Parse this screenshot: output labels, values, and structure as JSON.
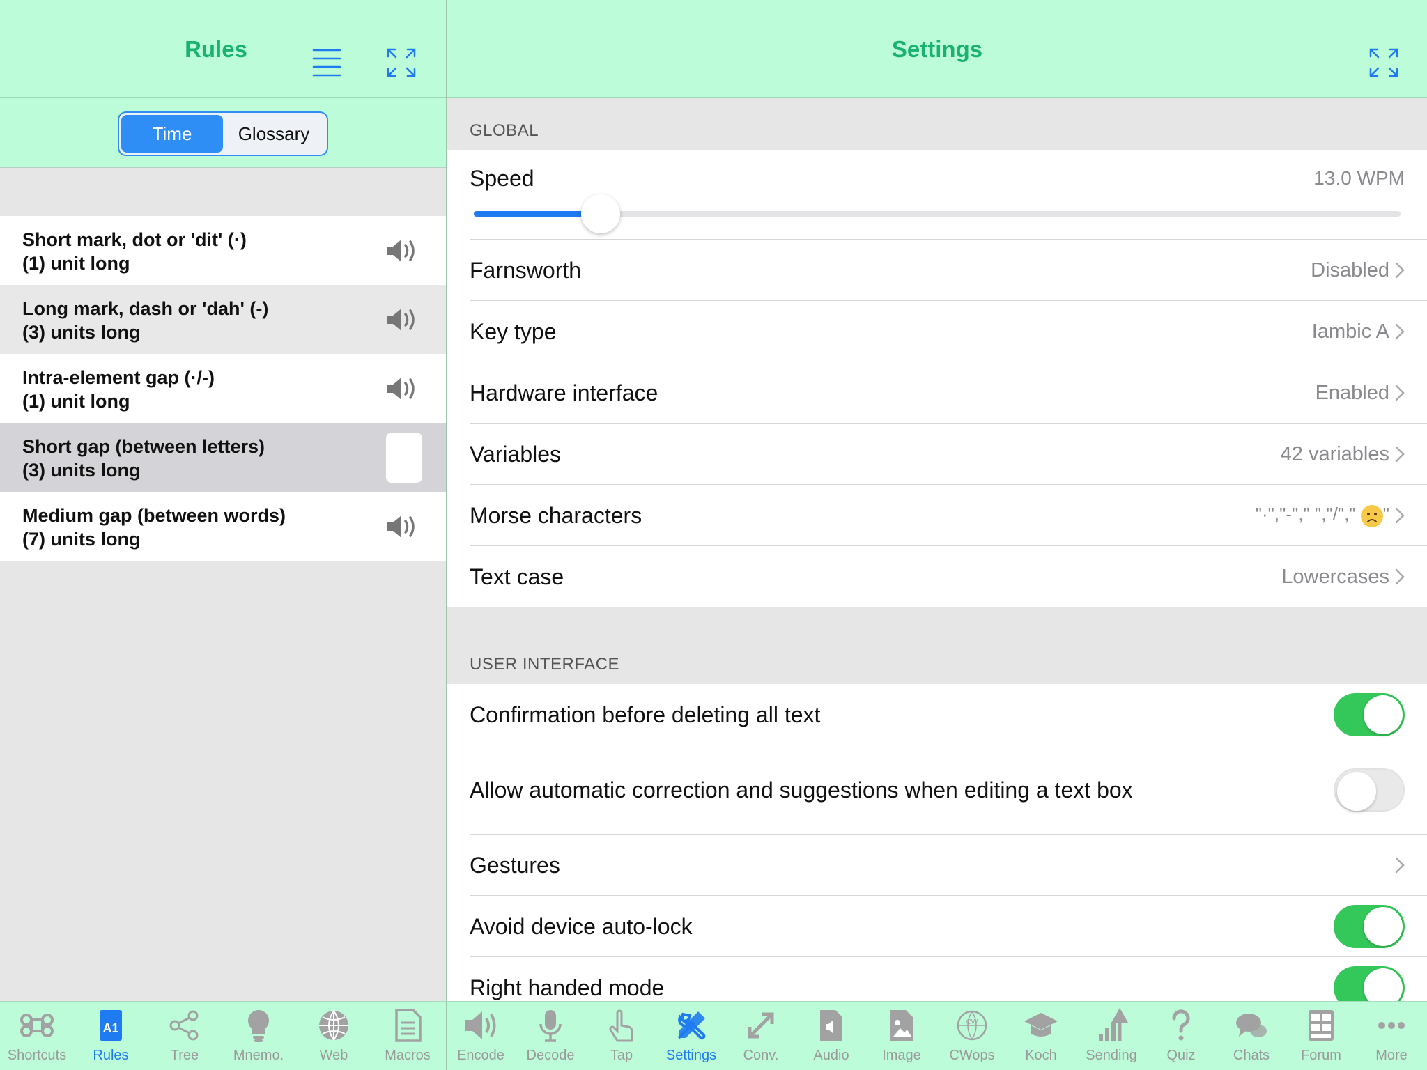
{
  "left": {
    "title": "Rules",
    "segments": [
      "Time",
      "Glossary"
    ],
    "selected_segment": "Time",
    "rules": [
      {
        "line1": "Short mark, dot or 'dit' (·)",
        "line2": "(1) unit long"
      },
      {
        "line1": "Long mark, dash or 'dah' (-)",
        "line2": "(3) units long"
      },
      {
        "line1": "Intra-element gap (·/-)",
        "line2": "(1) unit long"
      },
      {
        "line1": "Short gap (between letters)",
        "line2": "(3) units long"
      },
      {
        "line1": "Medium gap (between words)",
        "line2": "(7) units long"
      }
    ]
  },
  "right": {
    "title": "Settings",
    "global_header": "GLOBAL",
    "speed": {
      "label": "Speed",
      "value": "13.0 WPM",
      "slider_fraction": 0.137
    },
    "global_rows": [
      {
        "label": "Farnsworth",
        "value": "Disabled"
      },
      {
        "label": "Key type",
        "value": "Iambic A"
      },
      {
        "label": "Hardware interface",
        "value": "Enabled"
      },
      {
        "label": "Variables",
        "value": "42 variables"
      },
      {
        "label": "Morse characters",
        "value": "\"·\",\"-\",\" \",\"/\",\""
      },
      {
        "label": "Text case",
        "value": "Lowercases"
      }
    ],
    "morse_characters_suffix": "\"",
    "ui_header": "USER INTERFACE",
    "ui_rows": [
      {
        "label": "Confirmation before deleting all text",
        "toggle": true
      },
      {
        "label": "Allow automatic correction and suggestions when editing a text box",
        "toggle": false
      },
      {
        "label": "Gestures"
      },
      {
        "label": "Avoid device auto-lock",
        "toggle": true
      },
      {
        "label": "Right handed mode",
        "toggle": true
      }
    ]
  },
  "tabs": [
    {
      "label": "Shortcuts",
      "icon": "command-icon",
      "active": false
    },
    {
      "label": "Rules",
      "icon": "rules-book-icon",
      "active": true
    },
    {
      "label": "Tree",
      "icon": "tree-share-icon",
      "active": false
    },
    {
      "label": "Mnemo.",
      "icon": "lightbulb-icon",
      "active": false
    },
    {
      "label": "Web",
      "icon": "globe-icon",
      "active": false
    },
    {
      "label": "Macros",
      "icon": "document-icon",
      "active": false
    },
    {
      "label": "Encode",
      "icon": "speaker-icon",
      "active": false
    },
    {
      "label": "Decode",
      "icon": "microphone-icon",
      "active": false
    },
    {
      "label": "Tap",
      "icon": "hand-pointer-icon",
      "active": false
    },
    {
      "label": "Settings",
      "icon": "tools-icon",
      "active": true
    },
    {
      "label": "Conv.",
      "icon": "convert-arrows-icon",
      "active": false
    },
    {
      "label": "Audio",
      "icon": "audio-file-icon",
      "active": false
    },
    {
      "label": "Image",
      "icon": "image-file-icon",
      "active": false
    },
    {
      "label": "CWops",
      "icon": "cwops-logo-icon",
      "active": false
    },
    {
      "label": "Koch",
      "icon": "graduation-cap-icon",
      "active": false
    },
    {
      "label": "Sending",
      "icon": "bar-chart-up-icon",
      "active": false
    },
    {
      "label": "Quiz",
      "icon": "question-icon",
      "active": false
    },
    {
      "label": "Chats",
      "icon": "chat-bubbles-icon",
      "active": false
    },
    {
      "label": "Forum",
      "icon": "forum-board-icon",
      "active": false
    },
    {
      "label": "More",
      "icon": "ellipsis-icon",
      "active": false
    }
  ],
  "colors": {
    "accent": "#1e7bf2",
    "header_bg": "#bdfcd9",
    "title_green": "#1ab270",
    "toggle_on": "#34c759"
  }
}
